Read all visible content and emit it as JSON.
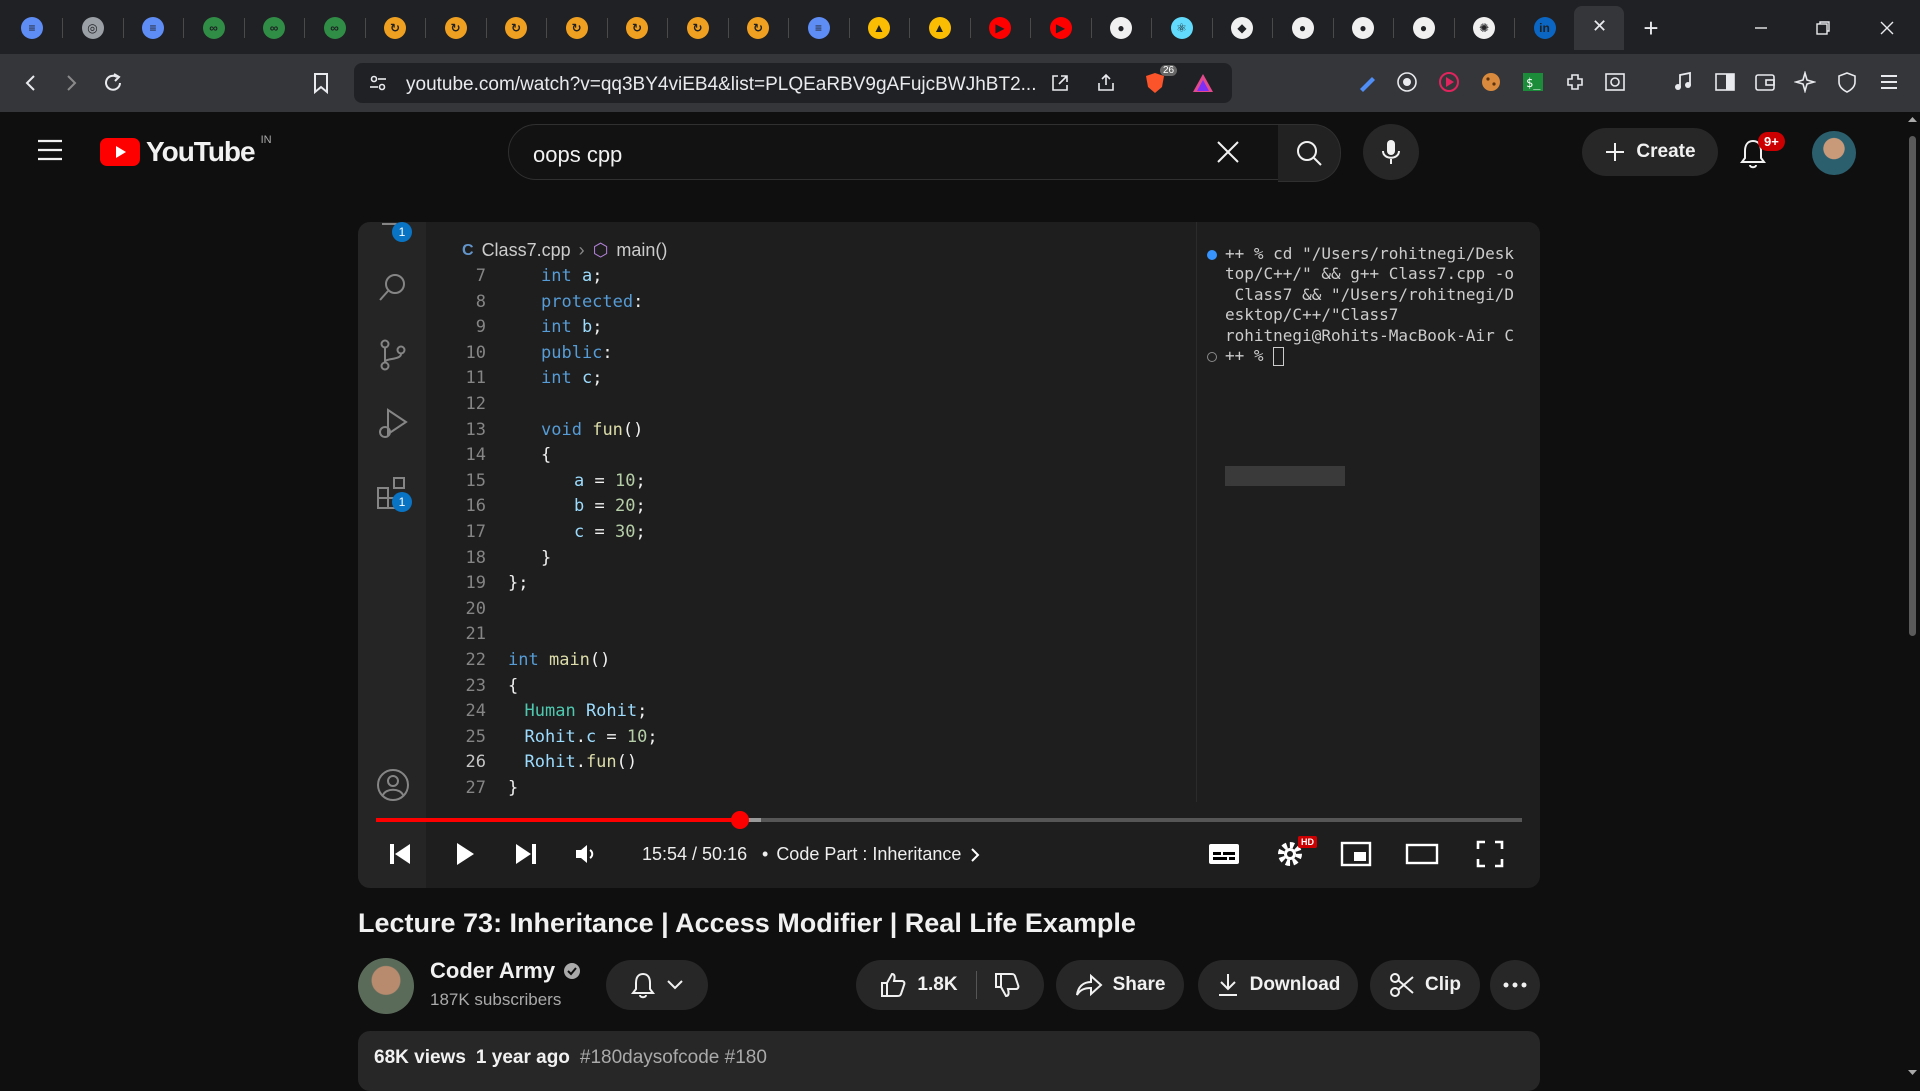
{
  "browser": {
    "tab_favicons": [
      {
        "name": "stack-icon",
        "color": "#5e8df5",
        "glyph": "≡"
      },
      {
        "name": "ide-icon",
        "color": "#9aa0a6",
        "glyph": "◎"
      },
      {
        "name": "stack-icon",
        "color": "#5e8df5",
        "glyph": "≡"
      },
      {
        "name": "gfg-icon",
        "color": "#2f8d46",
        "glyph": "∞"
      },
      {
        "name": "gfg-icon",
        "color": "#2f8d46",
        "glyph": "∞"
      },
      {
        "name": "gfg-icon",
        "color": "#2f8d46",
        "glyph": "∞"
      },
      {
        "name": "leetcode-icon",
        "color": "#f0a020",
        "glyph": "↻"
      },
      {
        "name": "leetcode-icon",
        "color": "#f0a020",
        "glyph": "↻"
      },
      {
        "name": "leetcode-icon",
        "color": "#f0a020",
        "glyph": "↻"
      },
      {
        "name": "leetcode-icon",
        "color": "#f0a020",
        "glyph": "↻"
      },
      {
        "name": "leetcode-icon",
        "color": "#f0a020",
        "glyph": "↻"
      },
      {
        "name": "leetcode-icon",
        "color": "#f0a020",
        "glyph": "↻"
      },
      {
        "name": "leetcode-icon",
        "color": "#f0a020",
        "glyph": "↻"
      },
      {
        "name": "stack-icon",
        "color": "#5e8df5",
        "glyph": "≡"
      },
      {
        "name": "drive-icon",
        "color": "#fbbc04",
        "glyph": "▲"
      },
      {
        "name": "drive-icon",
        "color": "#fbbc04",
        "glyph": "▲"
      },
      {
        "name": "youtube-icon",
        "color": "#ff0000",
        "glyph": "▶"
      },
      {
        "name": "youtube-icon",
        "color": "#ff0000",
        "glyph": "▶"
      },
      {
        "name": "github-icon",
        "color": "#f0f0f0",
        "glyph": "●"
      },
      {
        "name": "react-icon",
        "color": "#61dafb",
        "glyph": "⚛"
      },
      {
        "name": "vercel-icon",
        "color": "#f0f0f0",
        "glyph": "◆"
      },
      {
        "name": "github-icon",
        "color": "#f0f0f0",
        "glyph": "●"
      },
      {
        "name": "github-icon",
        "color": "#f0f0f0",
        "glyph": "●"
      },
      {
        "name": "github-icon",
        "color": "#f0f0f0",
        "glyph": "●"
      },
      {
        "name": "openai-icon",
        "color": "#f0f0f0",
        "glyph": "✺"
      },
      {
        "name": "linkedin-icon",
        "color": "#0a66c2",
        "glyph": "in"
      }
    ],
    "active_tab_close": "✕",
    "new_tab": "+",
    "url": "youtube.com/watch?v=qq3BY4viEB4&list=PLQEaRBV9gAFujcBWJhBT2...",
    "brave_badge": "26"
  },
  "youtube": {
    "logo_text": "YouTube",
    "region": "IN",
    "search_value": "oops cpp",
    "create_label": "Create",
    "notif_count": "9+"
  },
  "editor": {
    "breadcrumb_file": "Class7.cpp",
    "breadcrumb_symbol": "main()",
    "explorer_badge": "1",
    "extensions_badge": "1",
    "lines": [
      {
        "n": "7",
        "t": "int a;"
      },
      {
        "n": "8",
        "t": "protected:"
      },
      {
        "n": "9",
        "t": "int b;"
      },
      {
        "n": "10",
        "t": "public:"
      },
      {
        "n": "11",
        "t": "int c;"
      },
      {
        "n": "12",
        "t": ""
      },
      {
        "n": "13",
        "t": "void fun()"
      },
      {
        "n": "14",
        "t": "{"
      },
      {
        "n": "15",
        "t": "a = 10;"
      },
      {
        "n": "16",
        "t": "b = 20;"
      },
      {
        "n": "17",
        "t": "c = 30;"
      },
      {
        "n": "18",
        "t": "}"
      },
      {
        "n": "19",
        "t": "};"
      },
      {
        "n": "20",
        "t": ""
      },
      {
        "n": "21",
        "t": ""
      },
      {
        "n": "22",
        "t": "int main()"
      },
      {
        "n": "23",
        "t": "{"
      },
      {
        "n": "24",
        "t": "Human Rohit;"
      },
      {
        "n": "25",
        "t": "Rohit.c = 10;"
      },
      {
        "n": "26",
        "t": "Rohit.fun()"
      },
      {
        "n": "27",
        "t": "}"
      }
    ],
    "terminal": "++ % cd \"/Users/rohitnegi/Desk\ntop/C++/\" && g++ Class7.cpp -o\n Class7 && \"/Users/rohitnegi/D\nesktop/C++/\"Class7\nrohitnegi@Rohits-MacBook-Air C\n++ % "
  },
  "player": {
    "time": "15:54 / 50:16",
    "chapter_separator": "•",
    "chapter": "Code Part : Inheritance",
    "progress_played_fraction": 0.318,
    "progress_buffered_fraction": 0.336,
    "hd_badge": "HD"
  },
  "video": {
    "title": "Lecture 73: Inheritance | Access Modifier | Real Life Example",
    "channel_name": "Coder Army",
    "subscribers": "187K subscribers",
    "likes": "1.8K",
    "share_label": "Share",
    "download_label": "Download",
    "clip_label": "Clip",
    "views": "68K views",
    "age": "1 year ago",
    "tags": "#180daysofcode #180"
  }
}
